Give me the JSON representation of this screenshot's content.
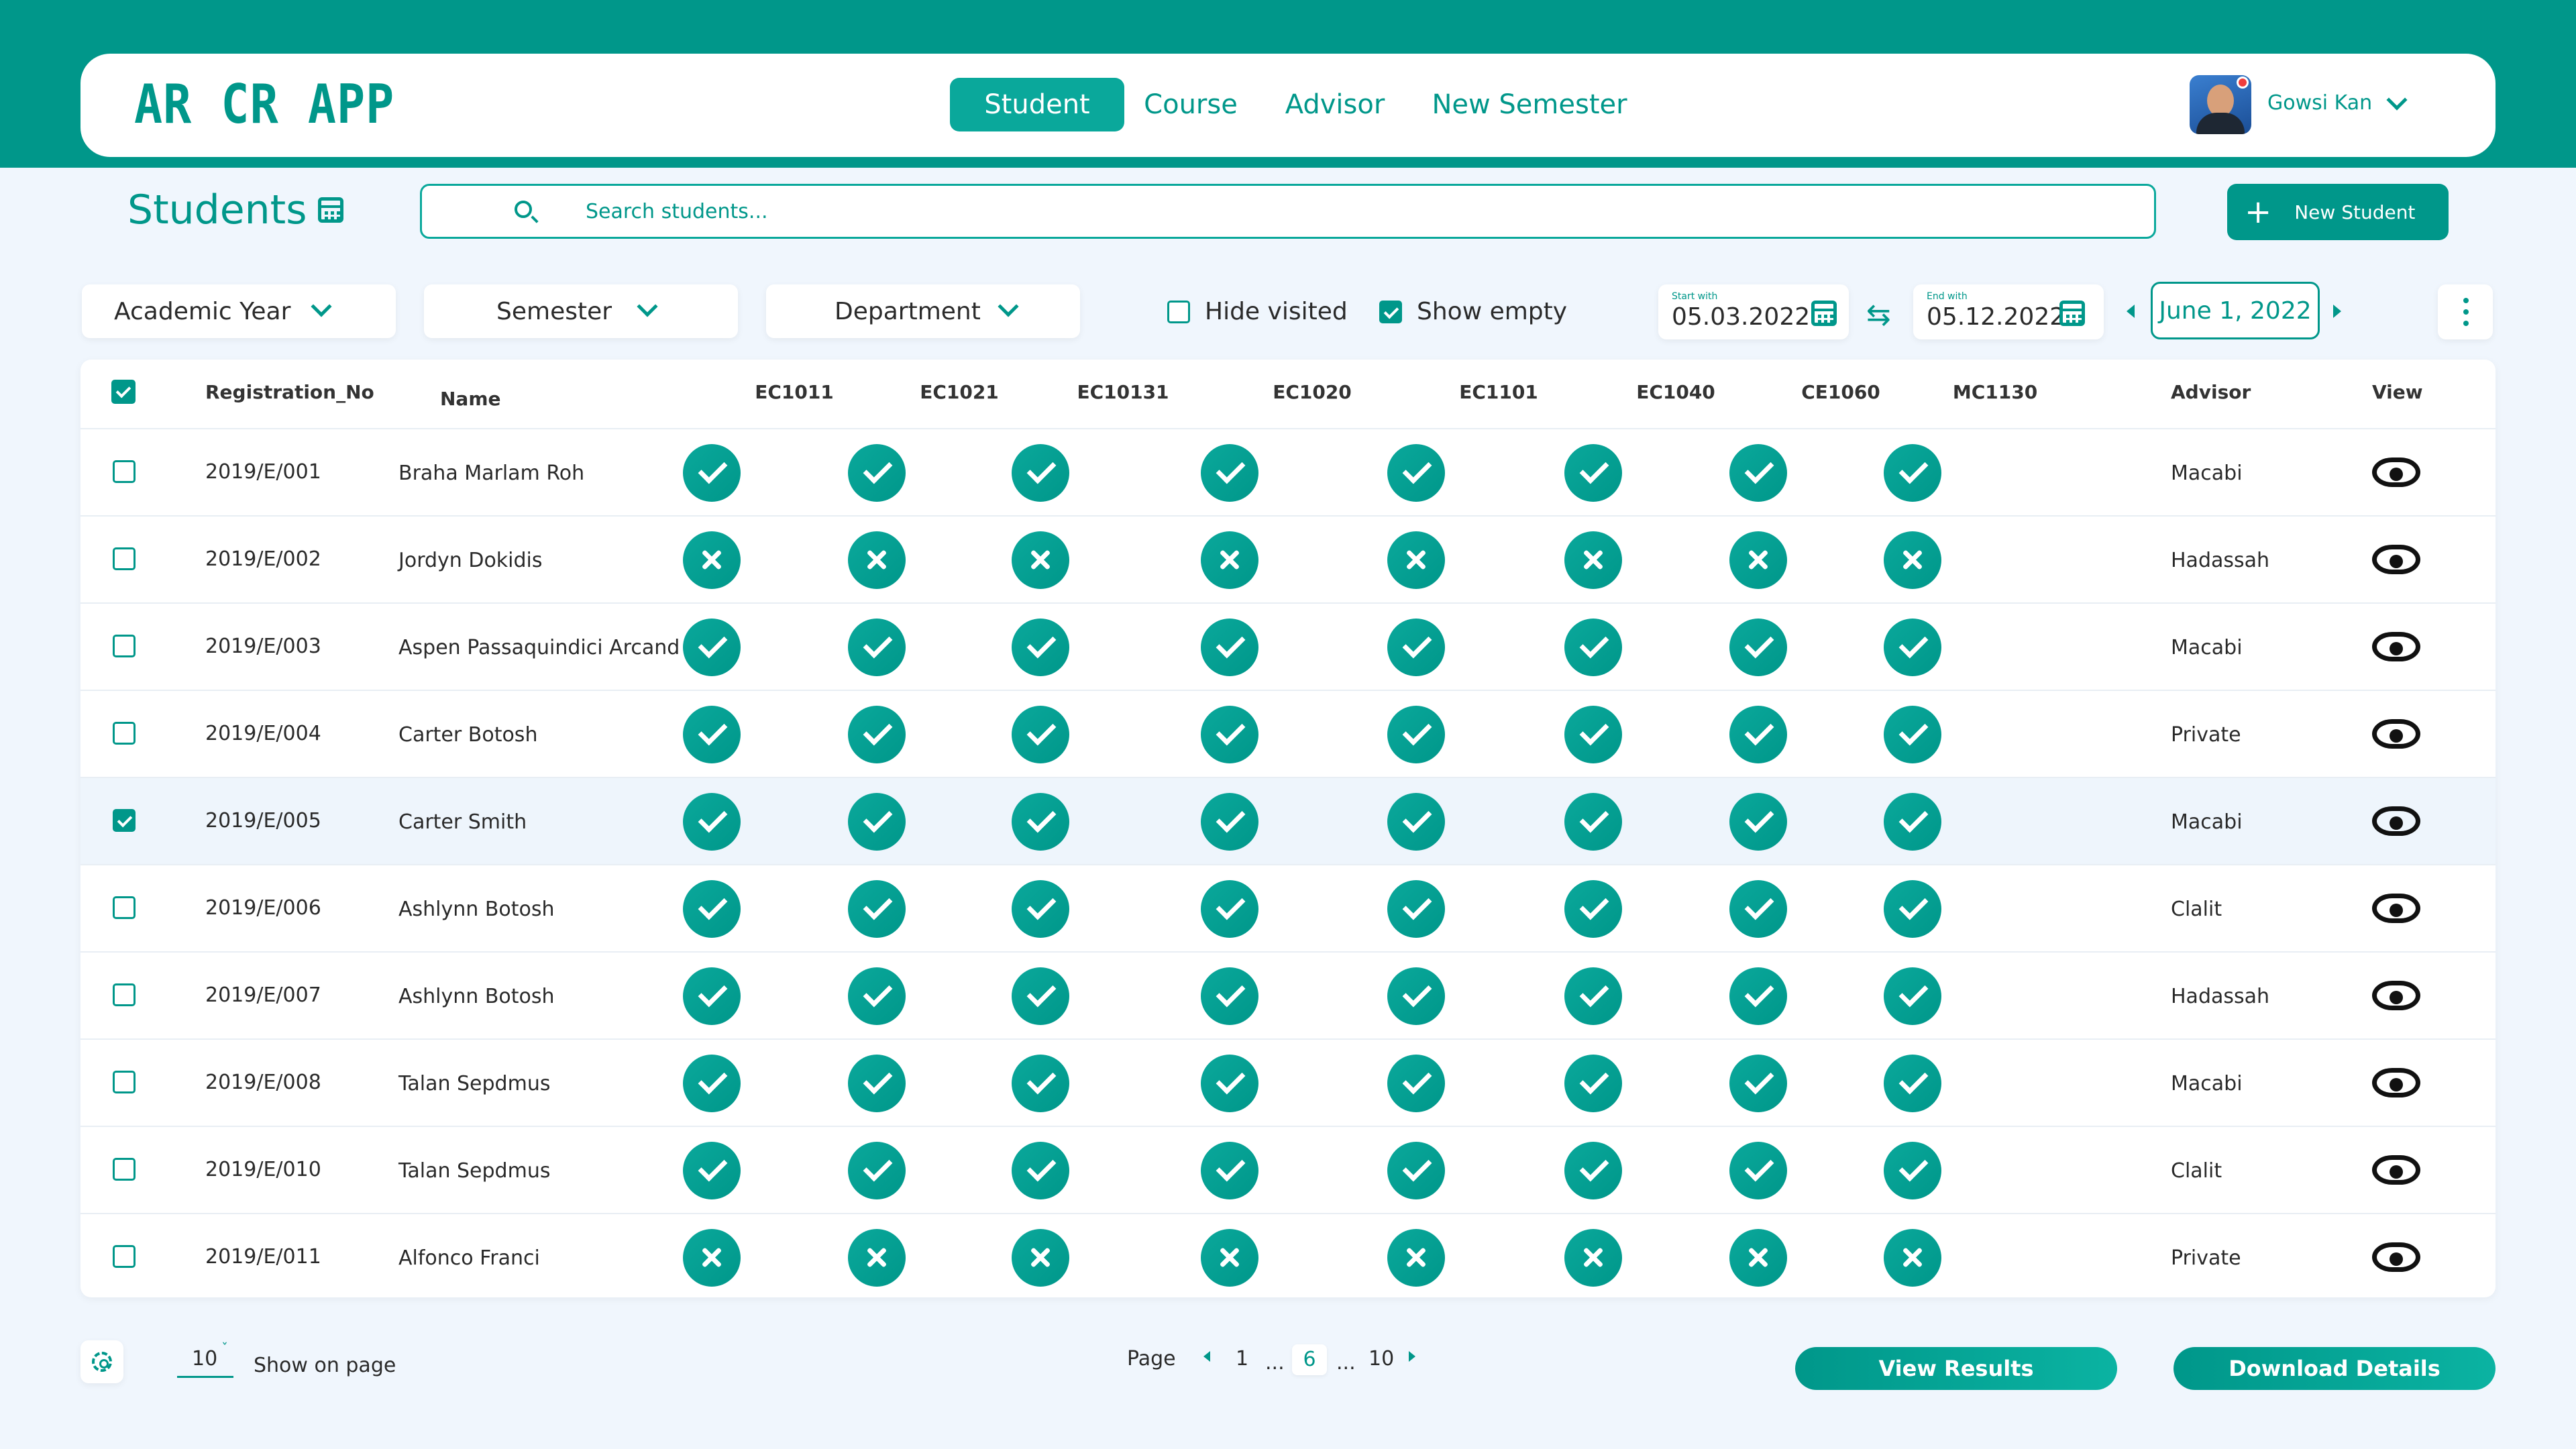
{
  "app": {
    "title": "AR CR APP"
  },
  "nav": {
    "items": [
      "Student",
      "Course",
      "Advisor",
      "New Semester"
    ],
    "active": "Student"
  },
  "user": {
    "name": "Gowsi Kan"
  },
  "page": {
    "title": "Students"
  },
  "search": {
    "placeholder": "Search students..."
  },
  "actions": {
    "new_student": "New Student"
  },
  "filters": {
    "academic_year": "Academic Year",
    "semester": "Semester",
    "department": "Department",
    "hide_visited": {
      "label": "Hide visited",
      "checked": false
    },
    "show_empty": {
      "label": "Show empty",
      "checked": true
    },
    "start": {
      "caption": "Start with",
      "value": "05.03.2022"
    },
    "end": {
      "caption": "End with",
      "value": "05.12.2022"
    },
    "current_date": "June 1, 2022"
  },
  "table": {
    "headers": {
      "reg": "Registration_No",
      "name": "Name",
      "advisor": "Advisor",
      "view": "View"
    },
    "courses": [
      "EC1011",
      "EC1021",
      "EC10131",
      "EC1020",
      "EC1101",
      "EC1040",
      "CE1060",
      "MC1130"
    ],
    "rows": [
      {
        "reg": "2019/E/001",
        "name": "Braha Marlam Roh",
        "status": "pass",
        "advisor": "Macabi",
        "selected": false
      },
      {
        "reg": "2019/E/002",
        "name": "Jordyn Dokidis",
        "status": "fail",
        "advisor": "Hadassah",
        "selected": false
      },
      {
        "reg": "2019/E/003",
        "name": "Aspen Passaquindici Arcand",
        "status": "pass",
        "advisor": "Macabi",
        "selected": false
      },
      {
        "reg": "2019/E/004",
        "name": "Carter Botosh",
        "status": "pass",
        "advisor": "Private",
        "selected": false
      },
      {
        "reg": "2019/E/005",
        "name": "Carter Smith",
        "status": "pass",
        "advisor": "Macabi",
        "selected": true
      },
      {
        "reg": "2019/E/006",
        "name": "Ashlynn Botosh",
        "status": "pass",
        "advisor": "Clalit",
        "selected": false
      },
      {
        "reg": "2019/E/007",
        "name": "Ashlynn Botosh",
        "status": "pass",
        "advisor": "Hadassah",
        "selected": false
      },
      {
        "reg": "2019/E/008",
        "name": "Talan Sepdmus",
        "status": "pass",
        "advisor": "Macabi",
        "selected": false
      },
      {
        "reg": "2019/E/010",
        "name": "Talan Sepdmus",
        "status": "pass",
        "advisor": "Clalit",
        "selected": false
      },
      {
        "reg": "2019/E/011",
        "name": "Alfonco Franci",
        "status": "fail",
        "advisor": "Private",
        "selected": false
      }
    ]
  },
  "footer": {
    "per_page": "10",
    "show_on_page": "Show on page",
    "page_label": "Page",
    "pages": [
      "1",
      "...",
      "6",
      "...",
      "10"
    ],
    "current_page": "6",
    "view_results": "View Results",
    "download_details": "Download Details"
  },
  "colors": {
    "brand": "#00978a",
    "accent": "#0aa89b",
    "background": "#f0f6fd"
  }
}
